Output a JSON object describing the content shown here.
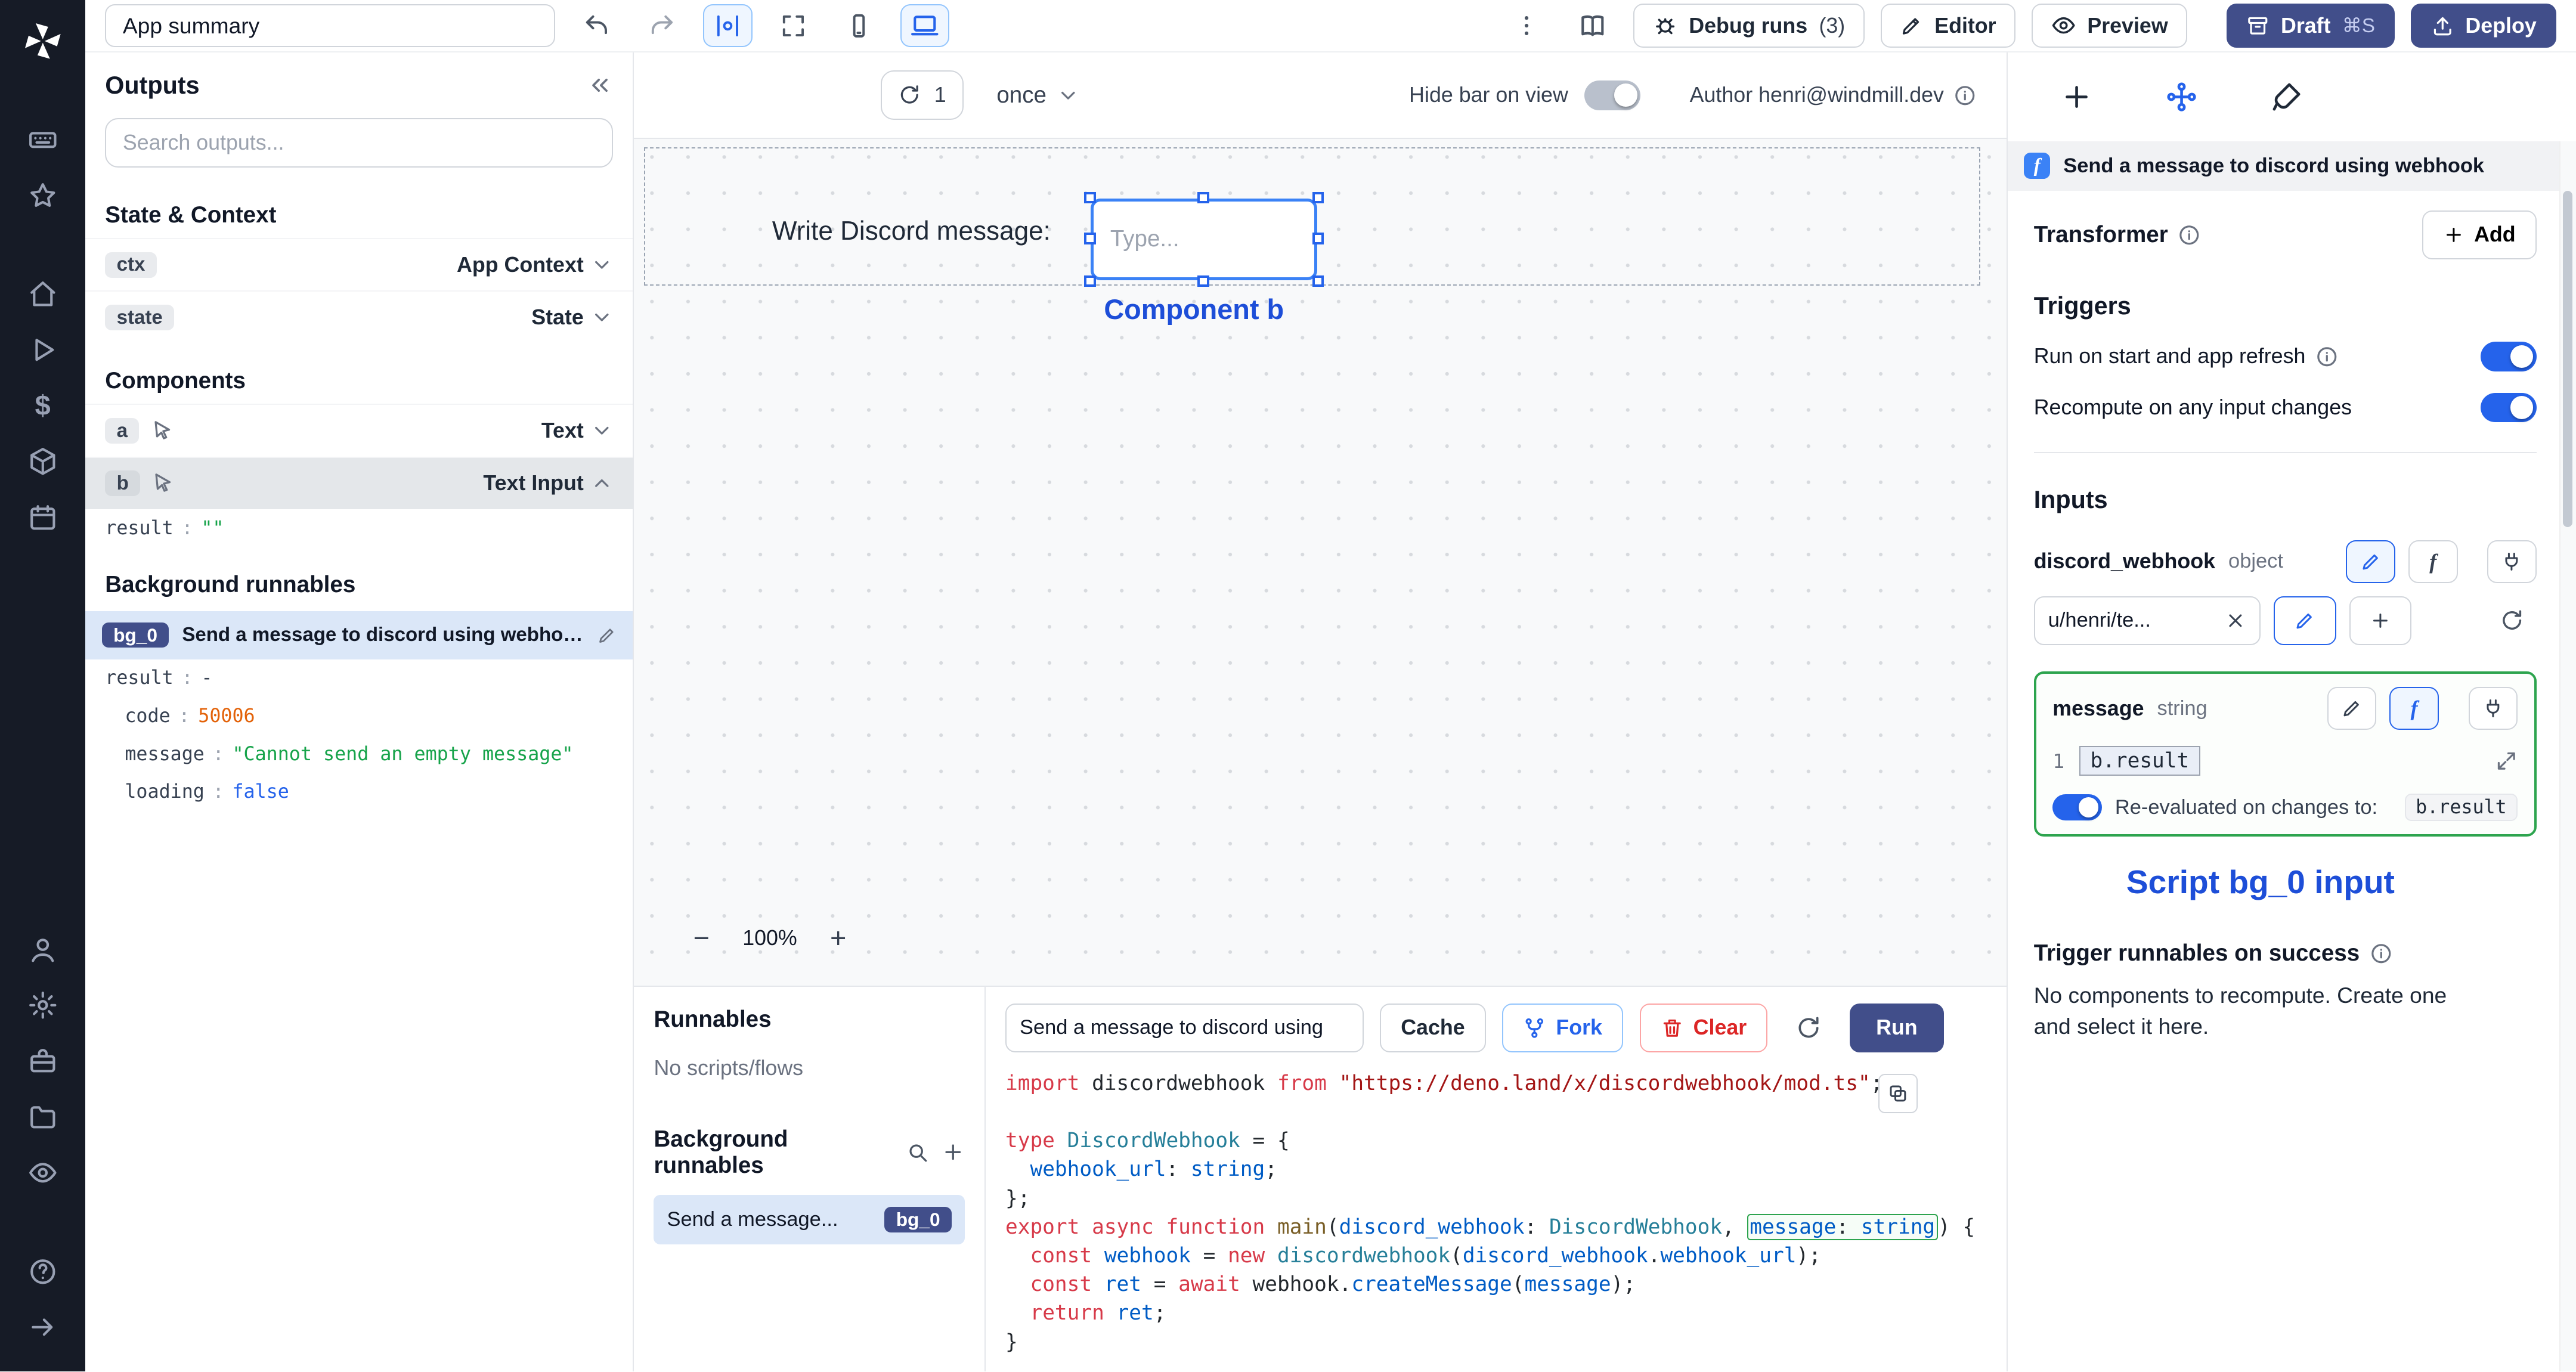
{
  "icons": {
    "dollar": "$"
  },
  "topbar": {
    "app_summary_value": "App summary",
    "debug_runs_label": "Debug runs",
    "debug_runs_count": "(3)",
    "editor_label": "Editor",
    "preview_label": "Preview",
    "draft_label": "Draft",
    "draft_shortcut": "⌘S",
    "deploy_label": "Deploy"
  },
  "canvas_bar": {
    "refresh_count": "1",
    "schedule_value": "once",
    "hide_bar_label": "Hide bar on view",
    "author_label": "Author henri@windmill.dev"
  },
  "canvas": {
    "text_component": "Write Discord message:",
    "input_placeholder": "Type...",
    "annotation": "Component b",
    "zoom_minus": "−",
    "zoom_level": "100%",
    "zoom_plus": "+"
  },
  "outputs": {
    "title": "Outputs",
    "search_placeholder": "Search outputs...",
    "state_context_header": "State & Context",
    "ctx_badge": "ctx",
    "ctx_label": "App Context",
    "state_badge": "state",
    "state_label": "State",
    "components_header": "Components",
    "a_badge": "a",
    "a_label": "Text",
    "b_badge": "b",
    "b_label": "Text Input",
    "b_result_key": "result",
    "b_result_value": "\"\"",
    "background_header": "Background runnables",
    "bg0_badge": "bg_0",
    "bg0_label": "Send a message to discord using webhook",
    "bg0_result_key": "result",
    "bg0_result_value": "-",
    "bg0_fields": [
      {
        "key": "code",
        "value": "50006",
        "color": "num"
      },
      {
        "key": "message",
        "value": "\"Cannot send an empty message\"",
        "color": "str"
      },
      {
        "key": "loading",
        "value": "false",
        "color": "bool"
      }
    ]
  },
  "runnables": {
    "title": "Runnables",
    "empty_label": "No scripts/flows",
    "background_header": "Background runnables",
    "item_label": "Send a message...",
    "item_badge": "bg_0"
  },
  "code_panel": {
    "title_value": "Send a message to discord using",
    "cache_label": "Cache",
    "fork_label": "Fork",
    "clear_label": "Clear",
    "run_label": "Run"
  },
  "code": {
    "lines": [
      [
        {
          "t": "import",
          "c": "kw"
        },
        {
          "t": " discordwebhook ",
          "c": "pl"
        },
        {
          "t": "from",
          "c": "kw"
        },
        {
          "t": " ",
          "c": "pl"
        },
        {
          "t": "\"https://deno.land/x/discordwebhook/mod.ts\"",
          "c": "str"
        },
        {
          "t": ";",
          "c": "pl"
        }
      ],
      [],
      [
        {
          "t": "type",
          "c": "kw"
        },
        {
          "t": " ",
          "c": "pl"
        },
        {
          "t": "DiscordWebhook",
          "c": "type"
        },
        {
          "t": " = {",
          "c": "pl"
        }
      ],
      [
        {
          "t": "  ",
          "c": "pl"
        },
        {
          "t": "webhook_url",
          "c": "var"
        },
        {
          "t": ": ",
          "c": "pl"
        },
        {
          "t": "string",
          "c": "var"
        },
        {
          "t": ";",
          "c": "pl"
        }
      ],
      [
        {
          "t": "};",
          "c": "pl"
        }
      ],
      [
        {
          "t": "export",
          "c": "kw"
        },
        {
          "t": " ",
          "c": "pl"
        },
        {
          "t": "async",
          "c": "kw"
        },
        {
          "t": " ",
          "c": "pl"
        },
        {
          "t": "function",
          "c": "kw"
        },
        {
          "t": " ",
          "c": "pl"
        },
        {
          "t": "main",
          "c": "fn"
        },
        {
          "t": "(",
          "c": "pl"
        },
        {
          "t": "discord_webhook",
          "c": "var"
        },
        {
          "t": ": ",
          "c": "pl"
        },
        {
          "t": "DiscordWebhook",
          "c": "type"
        },
        {
          "t": ", ",
          "c": "pl"
        },
        {
          "t": "message",
          "c": "var",
          "b": 1
        },
        {
          "t": ": ",
          "c": "pl",
          "b": 1
        },
        {
          "t": "string",
          "c": "var",
          "b": 1
        },
        {
          "t": ") {",
          "c": "pl"
        }
      ],
      [
        {
          "t": "  ",
          "c": "pl"
        },
        {
          "t": "const",
          "c": "kw"
        },
        {
          "t": " ",
          "c": "pl"
        },
        {
          "t": "webhook",
          "c": "var"
        },
        {
          "t": " = ",
          "c": "pl"
        },
        {
          "t": "new",
          "c": "kw"
        },
        {
          "t": " ",
          "c": "pl"
        },
        {
          "t": "discordwebhook",
          "c": "type"
        },
        {
          "t": "(",
          "c": "pl"
        },
        {
          "t": "discord_webhook",
          "c": "var"
        },
        {
          "t": ".",
          "c": "pl"
        },
        {
          "t": "webhook_url",
          "c": "var"
        },
        {
          "t": ");",
          "c": "pl"
        }
      ],
      [
        {
          "t": "  ",
          "c": "pl"
        },
        {
          "t": "const",
          "c": "kw"
        },
        {
          "t": " ",
          "c": "pl"
        },
        {
          "t": "ret",
          "c": "var"
        },
        {
          "t": " = ",
          "c": "pl"
        },
        {
          "t": "await",
          "c": "kw"
        },
        {
          "t": " ",
          "c": "pl"
        },
        {
          "t": "webhook",
          "c": "pl"
        },
        {
          "t": ".",
          "c": "pl"
        },
        {
          "t": "createMessage",
          "c": "var"
        },
        {
          "t": "(",
          "c": "pl"
        },
        {
          "t": "message",
          "c": "var"
        },
        {
          "t": ");",
          "c": "pl"
        }
      ],
      [
        {
          "t": "  ",
          "c": "pl"
        },
        {
          "t": "return",
          "c": "kw"
        },
        {
          "t": " ",
          "c": "pl"
        },
        {
          "t": "ret",
          "c": "var"
        },
        {
          "t": ";",
          "c": "pl"
        }
      ],
      [
        {
          "t": "}",
          "c": "pl"
        }
      ]
    ]
  },
  "right_panel": {
    "header_title": "Send a message to discord using webhook",
    "transformer_label": "Transformer",
    "add_label": "Add",
    "triggers_header": "Triggers",
    "trigger_start_label": "Run on start and app refresh",
    "trigger_recompute_label": "Recompute on any input changes",
    "inputs_header": "Inputs",
    "discord_webhook": {
      "name": "discord_webhook",
      "type": "object",
      "value": "u/henri/te..."
    },
    "message": {
      "name": "message",
      "type": "string",
      "line_number": "1",
      "expr": "b.result",
      "reeval_label": "Re-evaluated on changes to:",
      "reeval_badge": "b.result"
    },
    "annotation": "Script bg_0 input",
    "success_header": "Trigger runnables on success",
    "success_desc": "No components to recompute. Create one and select it here."
  }
}
